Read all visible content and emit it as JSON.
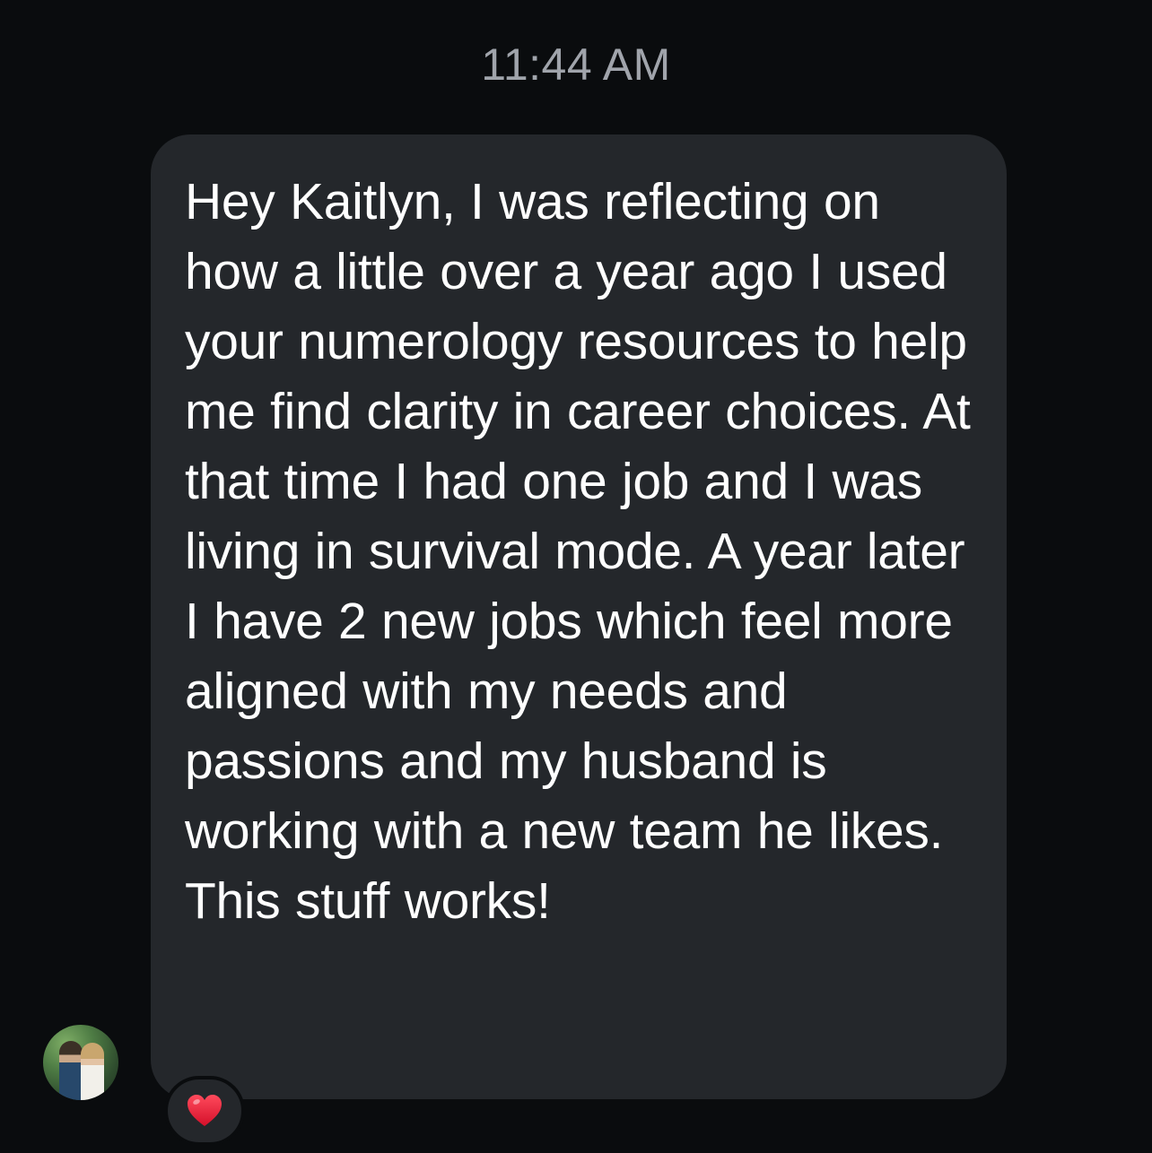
{
  "chat": {
    "timestamp": "11:44 AM",
    "message": {
      "text": "Hey Kaitlyn, I was reflecting on how a little over a year ago I used your numerology resources to help me find clarity in career choices. At that time I had one job and I was living in survival mode. A year later I have 2 new jobs which feel more aligned with my needs and passions and my husband is working with a new team he likes. This stuff works!",
      "reaction": {
        "icon": "heart-icon",
        "color": "#e2162d"
      }
    },
    "sender": {
      "avatar_icon": "avatar-couple-photo"
    }
  },
  "colors": {
    "background": "#0a0c0e",
    "bubble": "#24272b",
    "text": "#ffffff",
    "timestamp": "#a0a4ab"
  }
}
